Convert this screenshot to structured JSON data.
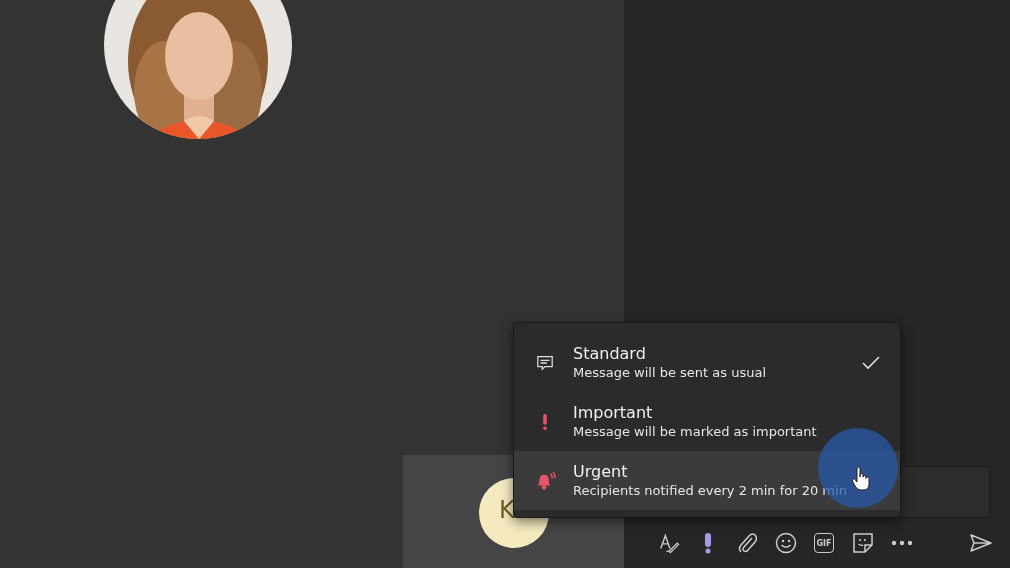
{
  "participant_tile": {
    "initials": "K"
  },
  "priority_menu": {
    "items": [
      {
        "kind": "standard",
        "title": "Standard",
        "description": "Message will be sent as usual",
        "checked": true,
        "highlighted": false
      },
      {
        "kind": "important",
        "title": "Important",
        "description": "Message will be marked as important",
        "checked": false,
        "highlighted": false
      },
      {
        "kind": "urgent",
        "title": "Urgent",
        "description": "Recipients notified every 2 min for 20 min",
        "checked": false,
        "highlighted": true
      }
    ]
  },
  "toolbar": {
    "items": [
      {
        "kind": "format"
      },
      {
        "kind": "priority"
      },
      {
        "kind": "attach"
      },
      {
        "kind": "emoji"
      },
      {
        "kind": "gif",
        "label": "GIF"
      },
      {
        "kind": "sticker"
      },
      {
        "kind": "more"
      },
      {
        "kind": "send"
      }
    ]
  }
}
